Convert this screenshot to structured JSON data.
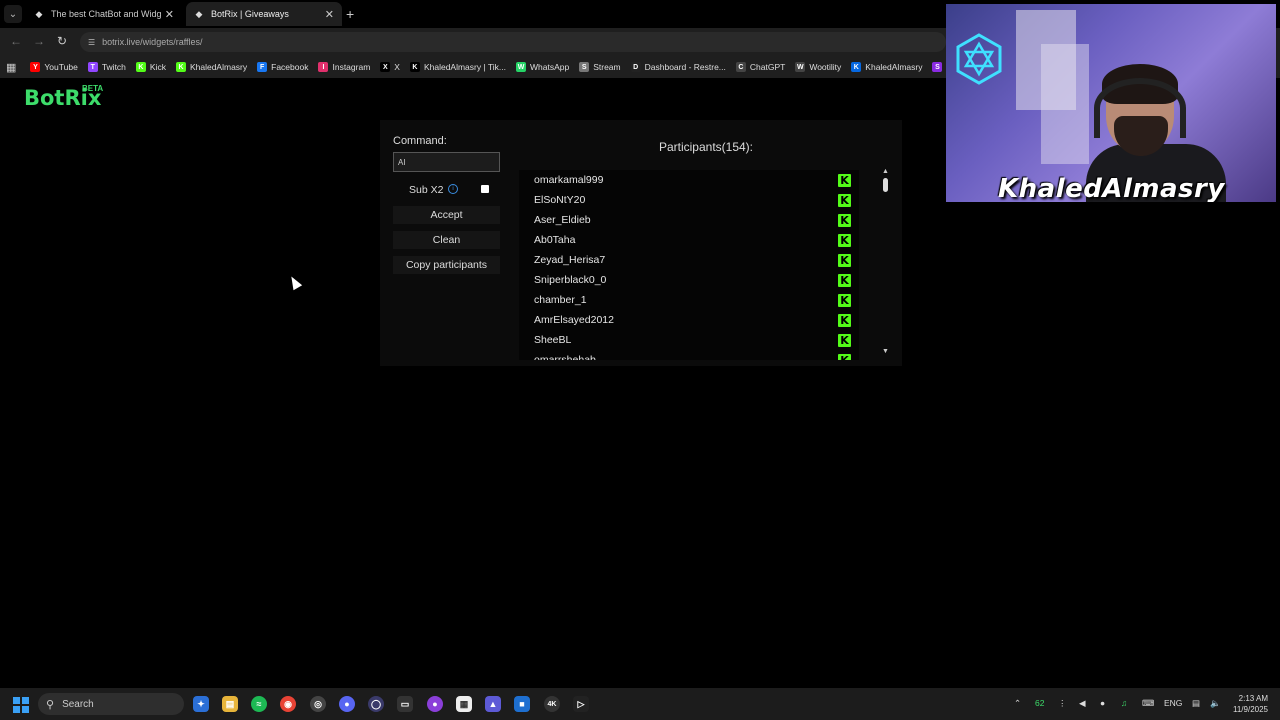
{
  "browser": {
    "tabs": [
      {
        "title": "The best ChatBot and Widgets",
        "active": false
      },
      {
        "title": "BotRix | Giveaways",
        "active": true
      }
    ],
    "url": "botrix.live/widgets/raffles/",
    "bookmarks": [
      {
        "label": "YouTube",
        "icon": "youtube-icon",
        "color": "#ff0000"
      },
      {
        "label": "Twitch",
        "icon": "twitch-icon",
        "color": "#9146ff"
      },
      {
        "label": "Kick",
        "icon": "kick-icon",
        "color": "#53fc18"
      },
      {
        "label": "KhaledAlmasry",
        "icon": "kick-icon",
        "color": "#53fc18"
      },
      {
        "label": "Facebook",
        "icon": "facebook-icon",
        "color": "#1877f2"
      },
      {
        "label": "Instagram",
        "icon": "instagram-icon",
        "color": "#e1306c"
      },
      {
        "label": "X",
        "icon": "x-icon",
        "color": "#000000"
      },
      {
        "label": "KhaledAlmasry | Tik...",
        "icon": "tiktok-icon",
        "color": "#000000"
      },
      {
        "label": "WhatsApp",
        "icon": "whatsapp-icon",
        "color": "#25d366"
      },
      {
        "label": "Stream",
        "icon": "folder-icon",
        "color": "#777777"
      },
      {
        "label": "Dashboard - Restre...",
        "icon": "restream-icon",
        "color": "#222222"
      },
      {
        "label": "ChatGPT",
        "icon": "chatgpt-icon",
        "color": "#444444"
      },
      {
        "label": "Wootility",
        "icon": "wootility-icon",
        "color": "#444444"
      },
      {
        "label": "KhaledAlmasry",
        "icon": "meta-icon",
        "color": "#0668e1"
      },
      {
        "label": "St",
        "icon": "stream-icon",
        "color": "#8a2be2"
      }
    ]
  },
  "app": {
    "logo": "BotRix",
    "logo_badge": "BETA",
    "accent": "#3ddc6a"
  },
  "raffle": {
    "command_label": "Command:",
    "command_value": "AI",
    "sub_label": "Sub X2",
    "sub_checked": false,
    "accept_label": "Accept",
    "clean_label": "Clean",
    "copy_label": "Copy participants",
    "participants_title": "Participants(154):",
    "participants": [
      "omarkamal999",
      "ElSoNtY20",
      "Aser_Eldieb",
      "Ab0Taha",
      "Zeyad_Herisa7",
      "Sniperblack0_0",
      "chamber_1",
      "AmrElsayed2012",
      "SheeBL",
      "omarrshehab"
    ],
    "platform_color": "#53fc18"
  },
  "webcam": {
    "streamer_name": "KhaledAlmasry"
  },
  "taskbar": {
    "search_placeholder": "Search",
    "tray_count": "62",
    "language": "ENG",
    "time": "2:13 AM",
    "date": "11/9/2025"
  }
}
